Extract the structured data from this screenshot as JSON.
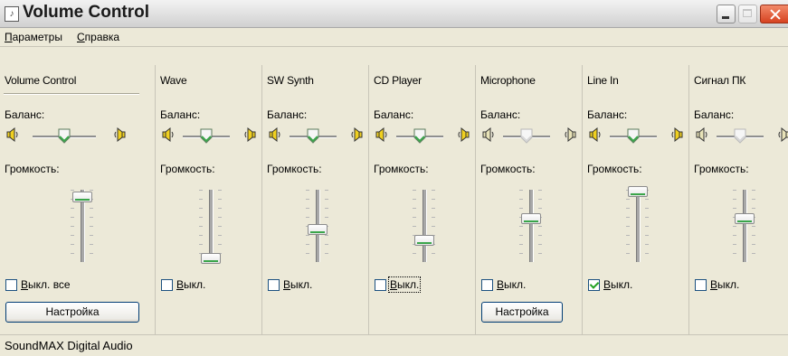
{
  "window": {
    "title": "Volume Control"
  },
  "menu": {
    "items": [
      {
        "label": "Параметры"
      },
      {
        "label": "Справка"
      }
    ]
  },
  "labels": {
    "balance": "Баланс:",
    "volume": "Громкость:"
  },
  "panels": [
    {
      "title": "Volume Control",
      "mute_label": "Выкл. все",
      "muted": false,
      "balance": 0,
      "volume": 0.9,
      "balance_enabled": true,
      "button_label": "Настройка"
    },
    {
      "title": "Wave",
      "mute_label": "Выкл.",
      "muted": false,
      "balance": 0,
      "volume": 0.05,
      "balance_enabled": true,
      "button_label": null
    },
    {
      "title": "SW Synth",
      "mute_label": "Выкл.",
      "muted": false,
      "balance": 0,
      "volume": 0.45,
      "balance_enabled": true,
      "button_label": null
    },
    {
      "title": "CD Player",
      "mute_label": "Выкл.",
      "muted": false,
      "balance": 0,
      "volume": 0.3,
      "balance_enabled": true,
      "button_label": null,
      "focused": true
    },
    {
      "title": "Microphone",
      "mute_label": "Выкл.",
      "muted": false,
      "balance": 0,
      "volume": 0.6,
      "balance_enabled": false,
      "button_label": "Настройка"
    },
    {
      "title": "Line In",
      "mute_label": "Выкл.",
      "muted": true,
      "balance": 0,
      "volume": 0.98,
      "balance_enabled": true,
      "button_label": null
    },
    {
      "title": "Сигнал ПК",
      "mute_label": "Выкл.",
      "muted": false,
      "balance": 0,
      "volume": 0.6,
      "balance_enabled": false,
      "button_label": null
    }
  ],
  "status": {
    "text": "SoundMAX Digital Audio"
  },
  "colors": {
    "accent_green": "#3aa54a",
    "speaker_yellow": "#f0d020",
    "close_red": "#d64220"
  },
  "icons": {
    "app": "speaker-icon",
    "balance_left": "speaker-left-icon",
    "balance_right": "speaker-right-icon"
  }
}
